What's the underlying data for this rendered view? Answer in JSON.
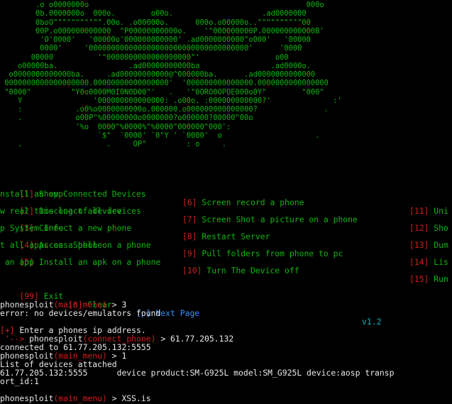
{
  "banner": {
    "lines": [
      "        .o o0000000o                                                 000o",
      "        0b.0000000o  000o.        o00o.                    .ad0000000",
      "        0boO\"\"\"\"\"\"\"\"\"\"\".00o. .o00000o.      000o.o00000o..\"\"\"\"\"\"\"\"\"\"00",
      "        00P.o000000000000  \"P00000000000o.    '\"000000000P.000000000000B'",
      "         'O'0000'   '00000o'000000000000' .ad0000000000\"o000'   '00000",
      "         0000'     '000000000000000000000000000000000000'      '0000",
      "       00000          '\"0000000000000000000\"'                 o00",
      "    o00000ba.                .ad00000000000ba                .ad0000o.",
      "  o0000000000000ba.     .ad00000000000@^000000ba.      .ad0000000000000",
      " 0000000000000000000.00000000000000000'  '000000000000000.0000000000000000",
      " \"0000\"         \"Y0o0000M0I0N0D00\"'   .   '\"0ORO0OPOE000o0Y\"        \"000\"",
      "    Y                '000000000000000: .o00o. :000000000000?'              :'",
      "    :            .o0%o0000000000o.000000.o000000000000000?               .",
      "    .            o00P\"%00000000o0000000?o000000?00000\"00o",
      "                 '%o  0000\"%0000%\"%0000\"000000\"000':",
      "                      `$\"  `0000' `0\"Y ' `0000'  o                     .",
      "    .                   .     OP\"         : o     ."
    ]
  },
  "menu": {
    "rows": [
      {
        "c1": {
          "num": "[1]",
          "label": " Show Connected Devices"
        },
        "c2": {
          "num": "[6]",
          "label": " Screen record a phone"
        },
        "c3": {
          "num": "[11]",
          "label": " Uni"
        },
        "wrap": "nstall an app"
      },
      {
        "c1": {
          "num": "[2]",
          "label": " Disconect all devices"
        },
        "c2": {
          "num": "[7]",
          "label": " Screen Shot a picture on a phone"
        },
        "c3": {
          "num": "[12]",
          "label": " Sho"
        },
        "wrap": "w real time log of device"
      },
      {
        "c1": {
          "num": "[3]",
          "label": " Connect a new phone"
        },
        "c2": {
          "num": "[8]",
          "label": " Restart Server"
        },
        "c3": {
          "num": "[13]",
          "label": " Dum"
        },
        "wrap": "p System Info"
      },
      {
        "c1": {
          "num": "[4]",
          "label": " Access Shell on a phone"
        },
        "c2": {
          "num": "[9]",
          "label": " Pull folders from phone to pc"
        },
        "c3": {
          "num": "[14]",
          "label": " Lis"
        },
        "wrap": "t all apps on a phone"
      },
      {
        "c1": {
          "num": "[5]",
          "label": " Install an apk on a phone"
        },
        "c2": {
          "num": "[10]",
          "label": " Turn The Device off"
        },
        "c3": {
          "num": "[15]",
          "label": " Run"
        },
        "wrap": " an app"
      }
    ],
    "exit": {
      "num": "[99]",
      "label": " Exit"
    },
    "clear": {
      "num": "[0]",
      "label": " Clear"
    },
    "next": {
      "num": "[p]",
      "label": " Next Page"
    },
    "version": "v1.2"
  },
  "session": {
    "prompt_name": "phonesploit",
    "menu_ctx": "(main_menu)",
    "phone_ctx": "(connect_phone)",
    "arrow": " > ",
    "cmd1": "3",
    "err1": "error: no devices/emulators found",
    "enter_marker": "[+]",
    "enter_text": " Enter a phones ip address.",
    "tree": " '--> ",
    "ip_input": "61.77.205.132",
    "connected": "connected to 61.77.205.132:5555",
    "cmd2": "1",
    "list_header": "List of devices attached",
    "device_line": "61.77.205.132:5555      device product:SM-G925L model:SM_G925L device:aosp transp",
    "device_wrap": "ort_id:1",
    "cmd3": "XSS.is"
  },
  "colors": {
    "background": "#000000",
    "banner_green": "#0bb40b",
    "menu_green": "#10b510",
    "number_red": "#cc1f1f",
    "next_page_blue": "#3a8fff",
    "version_cyan": "#18b3b3",
    "text_white": "#e8e8e8"
  }
}
